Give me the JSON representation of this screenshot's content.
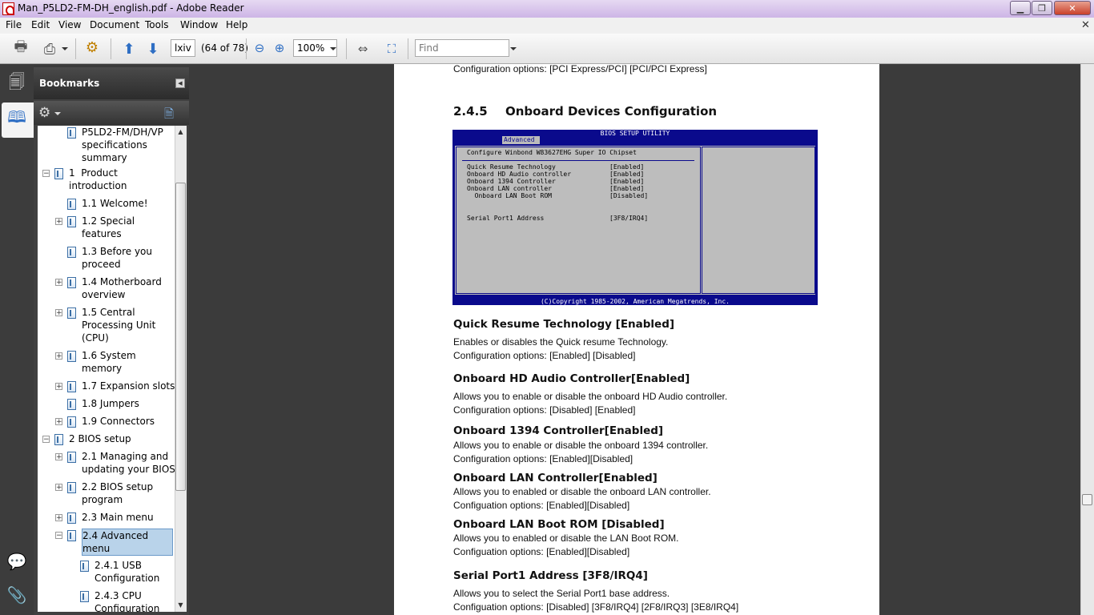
{
  "window": {
    "title": "Man_P5LD2-FM-DH_english.pdf - Adobe Reader"
  },
  "menu": {
    "items": [
      "File",
      "Edit",
      "View",
      "Document",
      "Tools",
      "Window",
      "Help"
    ]
  },
  "toolbar": {
    "page_field": "lxiv",
    "page_count": "(64 of 78)",
    "zoom": "100%",
    "find_placeholder": "Find"
  },
  "bookmarks": {
    "title": "Bookmarks",
    "items": [
      {
        "label": "P5LD2-FM/DH/VP\nspecifications\nsummary",
        "level": 1,
        "expander": ""
      },
      {
        "label": "1  Product\nintroduction",
        "level": 0,
        "expander": "−"
      },
      {
        "label": "1.1 Welcome!",
        "level": 1,
        "expander": ""
      },
      {
        "label": "1.2 Special\nfeatures",
        "level": 1,
        "expander": "+"
      },
      {
        "label": "1.3 Before you\nproceed",
        "level": 1,
        "expander": ""
      },
      {
        "label": "1.4 Motherboard\noverview",
        "level": 1,
        "expander": "+"
      },
      {
        "label": "1.5 Central\nProcessing Unit\n(CPU)",
        "level": 1,
        "expander": "+"
      },
      {
        "label": "1.6 System\nmemory",
        "level": 1,
        "expander": "+"
      },
      {
        "label": "1.7 Expansion slots",
        "level": 1,
        "expander": "+"
      },
      {
        "label": "1.8 Jumpers",
        "level": 1,
        "expander": ""
      },
      {
        "label": "1.9 Connectors",
        "level": 1,
        "expander": "+"
      },
      {
        "label": "2 BIOS setup",
        "level": 0,
        "expander": "−"
      },
      {
        "label": "2.1 Managing and\nupdating your BIOS",
        "level": 1,
        "expander": "+"
      },
      {
        "label": "2.2 BIOS setup\nprogram",
        "level": 1,
        "expander": "+"
      },
      {
        "label": "2.3 Main menu",
        "level": 1,
        "expander": "+"
      },
      {
        "label": "2.4 Advanced\nmenu",
        "level": 1,
        "expander": "−",
        "selected": true
      },
      {
        "label": "2.4.1 USB\nConfiguration",
        "level": 2,
        "expander": ""
      },
      {
        "label": "2.4.3 CPU\nConfiguration",
        "level": 2,
        "expander": ""
      }
    ]
  },
  "document": {
    "top_line": "Configuration options: [PCI Express/PCI] [PCI/PCI Express]",
    "section_number": "2.4.5",
    "section_title": "Onboard Devices Configuration",
    "bios": {
      "header": "BIOS SETUP UTILITY",
      "tab": "Advanced",
      "heading": "Configure Winbond W83627EHG Super IO Chipset",
      "rows": [
        {
          "name": "Quick Resume Technology",
          "value": "[Enabled]"
        },
        {
          "name": "Onboard HD Audio controller",
          "value": "[Enabled]"
        },
        {
          "name": "Onboard 1394 Controller",
          "value": "[Enabled]"
        },
        {
          "name": "Onboard LAN controller",
          "value": "[Enabled]"
        },
        {
          "name": "  Onboard LAN Boot ROM",
          "value": "[Disabled]"
        },
        {
          "name": "Serial Port1 Address",
          "value": "[3F8/IRQ4]"
        }
      ],
      "footer": "(C)Copyright 1985-2002, American Megatrends, Inc."
    },
    "sections": [
      {
        "heading": "Quick Resume Technology [Enabled]",
        "lines": [
          "Enables or disables the Quick resume Technology.",
          "Configuration options: [Enabled] [Disabled]"
        ]
      },
      {
        "heading": "Onboard HD Audio Controller[Enabled]",
        "lines": [
          "Allows you to enable or disable the onboard HD Audio controller.",
          "Configuration options: [Disabled] [Enabled]"
        ]
      },
      {
        "heading": "Onboard 1394 Controller[Enabled]",
        "lines": [
          "Allows you to enable or disable the onboard 1394 controller.",
          "Configuration options: [Enabled][Disabled]"
        ]
      },
      {
        "heading": "Onboard LAN Controller[Enabled]",
        "lines": [
          "Allows you to enabled or disable the onboard LAN controller.",
          "Configuation options: [Enabled][Disabled]"
        ]
      },
      {
        "heading": "Onboard LAN Boot ROM [Disabled]",
        "lines": [
          "Allows you to enabled or disable the LAN Boot ROM.",
          "Configuation options: [Enabled][Disabled]"
        ]
      },
      {
        "heading": "Serial Port1 Address [3F8/IRQ4]",
        "lines": [
          "Allows you to select the Serial Port1 base address.",
          "Configuation options: [Disabled] [3F8/IRQ4] [2F8/IRQ3] [3E8/IRQ4]"
        ]
      }
    ]
  }
}
